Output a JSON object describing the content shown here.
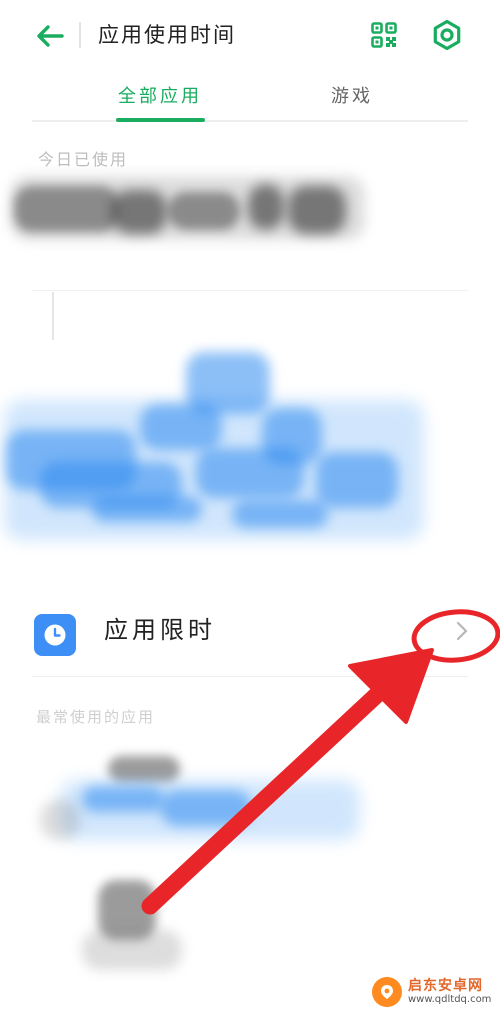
{
  "header": {
    "back_icon": "arrow-left-icon",
    "title": "应用使用时间",
    "qr_icon": "qr-code-icon",
    "settings_icon": "gear-icon"
  },
  "tabs": [
    {
      "label": "全部应用",
      "active": true
    },
    {
      "label": "游戏",
      "active": false
    }
  ],
  "usage": {
    "label": "今日已使用"
  },
  "limit_row": {
    "icon": "clock-icon",
    "label": "应用限时",
    "chevron_icon": "chevron-right-icon"
  },
  "recent": {
    "label": "最常使用的应用"
  },
  "watermark": {
    "name": "启东安卓网",
    "url": "www.qdltdq.com"
  },
  "colors": {
    "accent": "#1aad5f",
    "app_icon_blue": "#3d8ef5",
    "annotation_red": "#e8262a",
    "text_primary": "#222222",
    "text_secondary": "#666666"
  }
}
